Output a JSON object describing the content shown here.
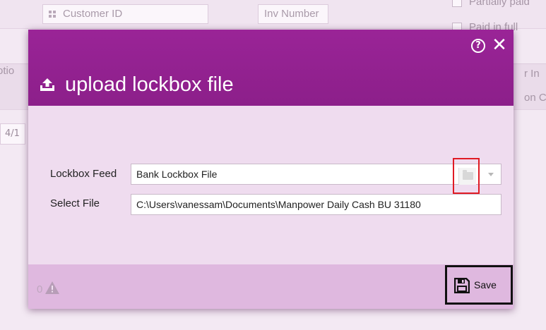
{
  "background": {
    "customer_id_placeholder": "Customer ID",
    "inv_number_placeholder": "Inv Number",
    "partially_paid_label": "Partially paid",
    "paid_in_full_label": "Paid in full",
    "left_cut_label": "otio",
    "right_cut_label_1": "r In",
    "right_cut_label_2": "on C",
    "date_cut": "4/1"
  },
  "dialog": {
    "title": "upload lockbox file",
    "help_glyph": "?",
    "close_glyph": "✕",
    "lockbox_feed_label": "Lockbox Feed",
    "lockbox_feed_value": "Bank Lockbox File",
    "select_file_label": "Select File",
    "select_file_value": "C:\\Users\\vanessam\\Documents\\Manpower Daily Cash BU 31180",
    "warning_count": "0",
    "save_label": "Save"
  },
  "colors": {
    "header": "#8c1f8a",
    "body": "#efdcef",
    "footer": "#dfb8df",
    "highlight_red": "#e01b24"
  }
}
